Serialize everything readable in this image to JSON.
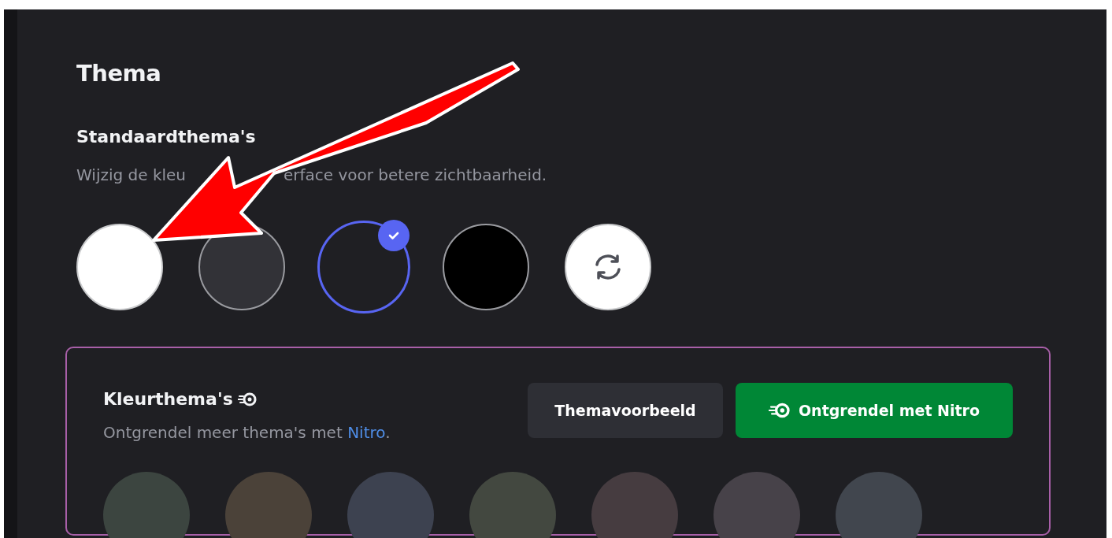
{
  "title": "Thema",
  "standard_themes": {
    "heading": "Standaardthema's",
    "description_parts": [
      "Wijzig de kleu",
      "erface voor betere zichtbaarheid."
    ],
    "swatches": [
      {
        "kind": "light",
        "selected": false
      },
      {
        "kind": "ash",
        "selected": false
      },
      {
        "kind": "dark",
        "selected": true
      },
      {
        "kind": "onyx",
        "selected": false
      },
      {
        "kind": "sync",
        "selected": false
      }
    ]
  },
  "color_themes": {
    "heading": "Kleurthema's",
    "description": "Ontgrendel meer thema's met ",
    "link": "Nitro",
    "description_end": ".",
    "buttons": [
      {
        "kind": "secondary",
        "label": "Themavoorbeeld"
      },
      {
        "kind": "nitro",
        "label": "Ontgrendel met Nitro"
      }
    ],
    "swatches": [
      {
        "color": "#3c4540"
      },
      {
        "color": "#4b4239"
      },
      {
        "color": "#3d4250"
      },
      {
        "color": "#434840"
      },
      {
        "color": "#463c40"
      },
      {
        "color": "#474249"
      },
      {
        "color": "#41464e"
      }
    ]
  }
}
